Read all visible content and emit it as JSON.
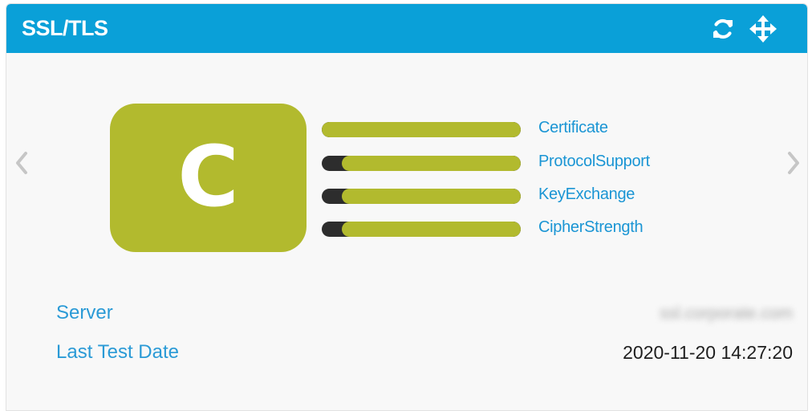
{
  "widget": {
    "title": "SSL/TLS",
    "grade": "C",
    "grade_color": "#b2ba2e",
    "header_color": "#0aa0d8",
    "icons": {
      "refresh": "refresh-icon",
      "move": "move-icon",
      "prev": "chevron-left-icon",
      "next": "chevron-right-icon"
    }
  },
  "metrics": [
    {
      "label": "Certificate",
      "score": 100
    },
    {
      "label": "ProtocolSupport",
      "score": 90
    },
    {
      "label": "KeyExchange",
      "score": 90
    },
    {
      "label": "CipherStrength",
      "score": 90
    }
  ],
  "info": {
    "server_label": "Server",
    "server_value": "ssl.corporate.com",
    "last_test_label": "Last Test Date",
    "last_test_value": "2020-11-20 14:27:20"
  }
}
